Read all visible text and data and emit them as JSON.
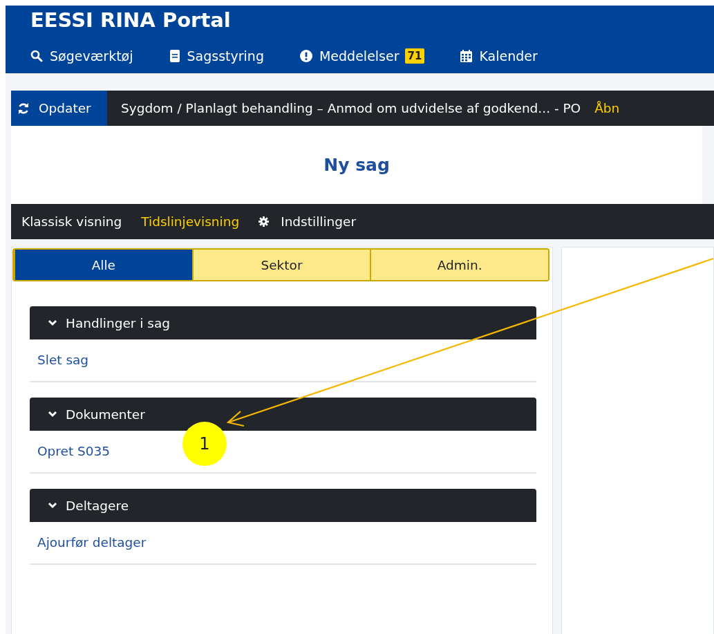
{
  "header": {
    "title": "EESSI RINA Portal",
    "nav": [
      {
        "label": "Søgeværktøj",
        "kind": "search"
      },
      {
        "label": "Sagsstyring",
        "kind": "document"
      },
      {
        "label": "Meddelelser",
        "kind": "alert",
        "badge": "71"
      },
      {
        "label": "Kalender",
        "kind": "calendar"
      }
    ]
  },
  "case_bar": {
    "refresh": "Opdater",
    "title": "Sygdom / Planlagt behandling – Anmod om udvidelse af godkend... - PO",
    "open": "Åbn"
  },
  "page_title": "Ny sag",
  "view_bar": [
    {
      "label": "Klassisk visning",
      "kind": "view",
      "selected": false
    },
    {
      "label": "Tidslinjevisning",
      "kind": "view",
      "selected": true
    },
    {
      "label": "Indstillinger",
      "kind": "settings",
      "selected": false
    }
  ],
  "tabs": [
    {
      "label": "Alle",
      "selected": true
    },
    {
      "label": "Sektor",
      "selected": false
    },
    {
      "label": "Admin.",
      "selected": false
    }
  ],
  "sections": [
    {
      "title": "Handlinger i sag",
      "expanded": true,
      "items": [
        "Slet sag"
      ]
    },
    {
      "title": "Dokumenter",
      "expanded": true,
      "items": [
        "Opret S035"
      ]
    },
    {
      "title": "Deltagere",
      "expanded": true,
      "items": [
        "Ajourfør deltager"
      ]
    }
  ],
  "annotation": {
    "label": "1"
  }
}
